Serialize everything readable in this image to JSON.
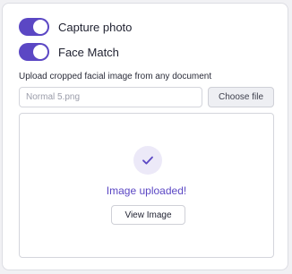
{
  "toggles": [
    {
      "label": "Capture photo",
      "on": true
    },
    {
      "label": "Face Match",
      "on": true
    }
  ],
  "upload": {
    "label": "Upload cropped facial image from any document",
    "placeholder": "Normal 5.png",
    "choose_label": "Choose file"
  },
  "preview": {
    "icon": "check-icon",
    "status": "Image uploaded!",
    "view_label": "View Image"
  },
  "colors": {
    "accent": "#5b47c4",
    "accent_light": "#ece9f8"
  }
}
